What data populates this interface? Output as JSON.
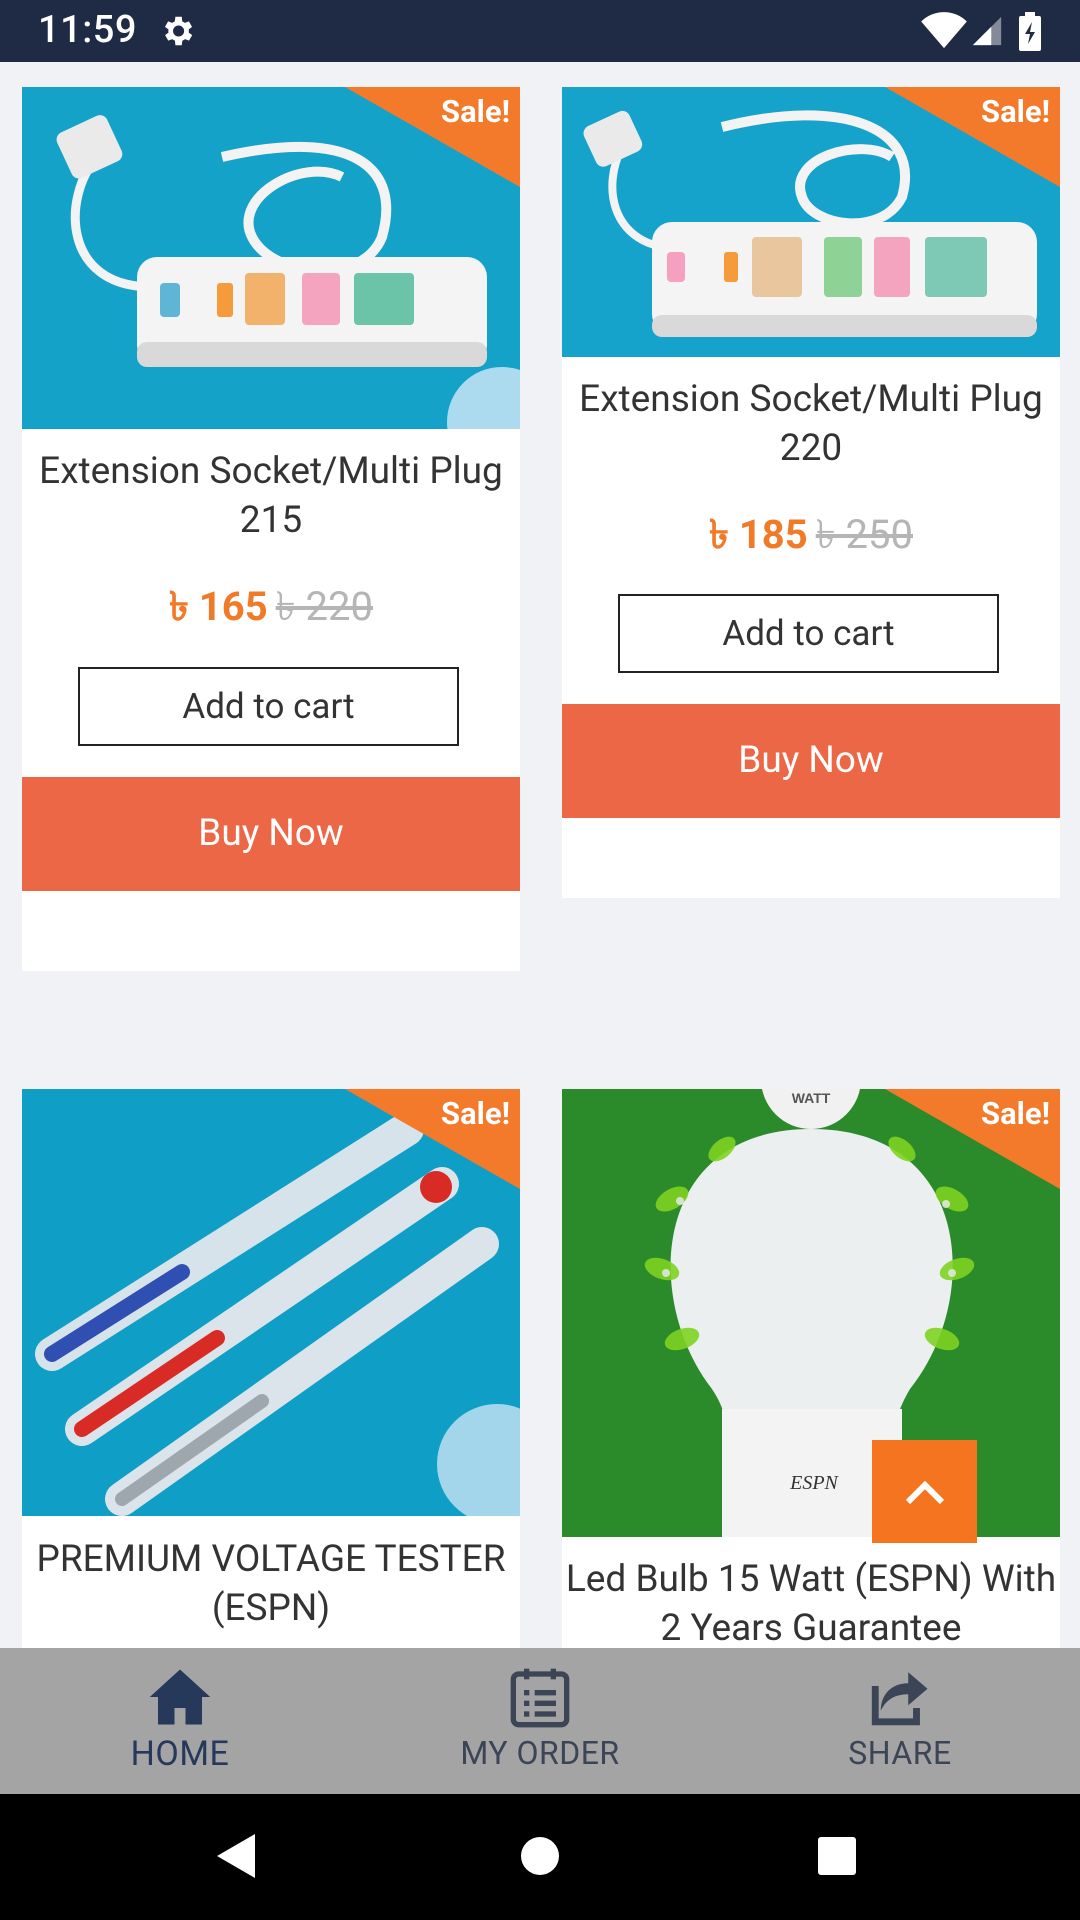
{
  "status_bar": {
    "time": "11:59",
    "icons": [
      "gear-icon",
      "wifi-icon",
      "signal-icon",
      "battery-icon"
    ]
  },
  "products": [
    {
      "badge": "Sale!",
      "title": "Extension Socket/Multi Plug 215",
      "price": "৳ 165",
      "old_price": "৳ 220",
      "add_to_cart": "Add to cart",
      "buy_now": "Buy Now",
      "image": "extension-socket-image"
    },
    {
      "badge": "Sale!",
      "title": "Extension Socket/Multi Plug 220",
      "price": "৳ 185",
      "old_price": "৳ 250",
      "add_to_cart": "Add to cart",
      "buy_now": "Buy Now",
      "image": "extension-socket-image"
    },
    {
      "badge": "Sale!",
      "title": "PREMIUM VOLTAGE TESTER (ESPN)",
      "image": "voltage-tester-image"
    },
    {
      "badge": "Sale!",
      "title": "Led Bulb 15 Watt (ESPN) With 2 Years Guarantee",
      "image": "led-bulb-image",
      "image_text": {
        "brand": "ESPN",
        "top": "WATT"
      }
    }
  ],
  "bottom_nav": {
    "items": [
      {
        "label": "HOME",
        "icon": "home-icon",
        "active": true
      },
      {
        "label": "MY ORDER",
        "icon": "order-list-icon",
        "active": false
      },
      {
        "label": "SHARE",
        "icon": "share-icon",
        "active": false
      }
    ]
  },
  "colors": {
    "status_bar": "#1f2b45",
    "sale_badge": "#f47a2b",
    "price": "#f07a27",
    "buy_now": "#ec6745",
    "nav_active": "#26395a",
    "nav_inactive": "#3b4555"
  }
}
